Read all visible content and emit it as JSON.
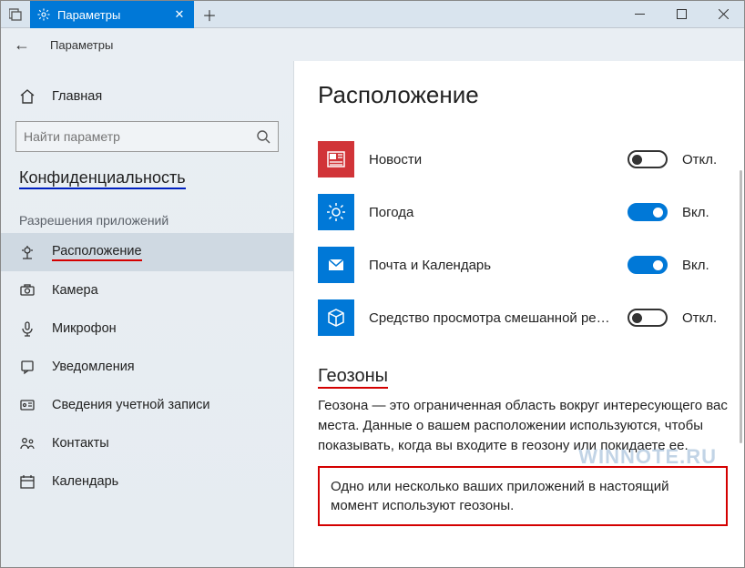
{
  "titlebar": {
    "tab_label": "Параметры"
  },
  "subheader": {
    "title": "Параметры"
  },
  "sidebar": {
    "home": "Главная",
    "search_placeholder": "Найти параметр",
    "category": "Конфиденциальность",
    "section": "Разрешения приложений",
    "items": [
      {
        "label": "Расположение"
      },
      {
        "label": "Камера"
      },
      {
        "label": "Микрофон"
      },
      {
        "label": "Уведомления"
      },
      {
        "label": "Сведения учетной записи"
      },
      {
        "label": "Контакты"
      },
      {
        "label": "Календарь"
      }
    ]
  },
  "main": {
    "heading": "Расположение",
    "apps": [
      {
        "name": "Новости",
        "state": "Откл.",
        "on": false,
        "icon": "news"
      },
      {
        "name": "Погода",
        "state": "Вкл.",
        "on": true,
        "icon": "weather"
      },
      {
        "name": "Почта и Календарь",
        "state": "Вкл.",
        "on": true,
        "icon": "mail"
      },
      {
        "name": "Средство просмотра смешанной реальн...",
        "state": "Откл.",
        "on": false,
        "icon": "cube"
      }
    ],
    "geofence_heading": "Геозоны",
    "geofence_desc": "Геозона — это ограниченная область вокруг интересующего вас места. Данные о вашем расположении используются, чтобы показывать, когда вы входите в геозону или покидаете ее.",
    "geofence_notice": "Одно или несколько ваших приложений в настоящий момент используют геозоны."
  },
  "watermark": "WINNOTE.RU"
}
